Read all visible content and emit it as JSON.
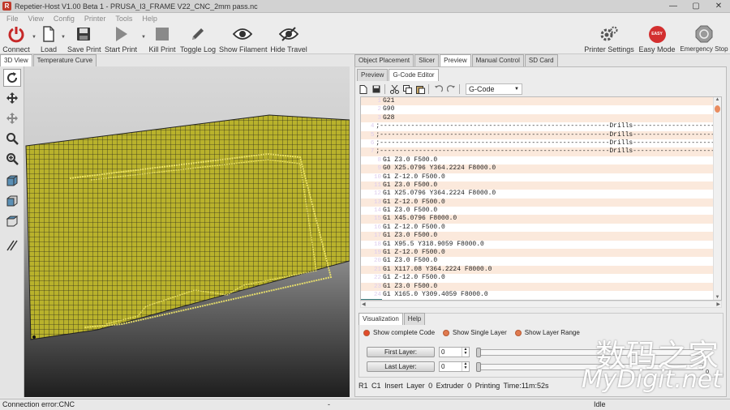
{
  "window": {
    "app_icon": "R",
    "title": "Repetier-Host V1.00 Beta 1 - PRUSA_I3_FRAME V22_CNC_2mm pass.nc",
    "minimize": "—",
    "maximize": "▢",
    "close": "✕"
  },
  "menu": [
    "File",
    "View",
    "Config",
    "Printer",
    "Tools",
    "Help"
  ],
  "toolbar": {
    "connect": "Connect",
    "load": "Load",
    "save_print": "Save Print",
    "start_print": "Start Print",
    "kill_print": "Kill Print",
    "toggle_log": "Toggle Log",
    "show_filament": "Show Filament",
    "hide_travel": "Hide Travel",
    "printer_settings": "Printer Settings",
    "easy_mode": "Easy Mode",
    "easy_badge": "EASY",
    "emergency_stop": "Emergency Stop"
  },
  "left_tabs": [
    "3D View",
    "Temperature Curve"
  ],
  "right_tabs": [
    "Object Placement",
    "Slicer",
    "Preview",
    "Manual Control",
    "SD Card"
  ],
  "preview_subtabs": [
    "Preview",
    "G-Code Editor"
  ],
  "editor": {
    "file_select": "G-Code",
    "lines": [
      {
        "n": "1",
        "code": "G21"
      },
      {
        "n": "2",
        "code": "G90"
      },
      {
        "n": "3",
        "code": "G28"
      },
      {
        "n": "4",
        "code": ";-----------------------------------------------------------Drills---------------------"
      },
      {
        "n": "5",
        "code": ";-----------------------------------------------------------Drills---------------------"
      },
      {
        "n": "6",
        "code": ";-----------------------------------------------------------Drills---------------------"
      },
      {
        "n": "7",
        "code": ";-----------------------------------------------------------Drills---------------------"
      },
      {
        "n": "8",
        "code": "G1 Z3.0 F500.0"
      },
      {
        "n": "9",
        "code": "G0 X25.0796 Y364.2224 F8000.0"
      },
      {
        "n": "10",
        "code": "G1 Z-12.0 F500.0"
      },
      {
        "n": "11",
        "code": "G1 Z3.0 F500.0"
      },
      {
        "n": "12",
        "code": "G1 X25.0796 Y364.2224 F8000.0"
      },
      {
        "n": "13",
        "code": "G1 Z-12.0 F500.0"
      },
      {
        "n": "14",
        "code": "G1 Z3.0 F500.0"
      },
      {
        "n": "15",
        "code": "G1 X45.0796 F8000.0"
      },
      {
        "n": "16",
        "code": "G1 Z-12.0 F500.0"
      },
      {
        "n": "17",
        "code": "G1 Z3.0 F500.0"
      },
      {
        "n": "18",
        "code": "G1 X95.5 Y318.9059 F8000.0"
      },
      {
        "n": "19",
        "code": "G1 Z-12.0 F500.0"
      },
      {
        "n": "20",
        "code": "G1 Z3.0 F500.0"
      },
      {
        "n": "21",
        "code": "G1 X117.08 Y364.2224 F8000.0"
      },
      {
        "n": "22",
        "code": "G1 Z-12.0 F500.0"
      },
      {
        "n": "23",
        "code": "G1 Z3.0 F500.0"
      },
      {
        "n": "24",
        "code": "G1 X165.0 Y309.4059 F8000.0"
      }
    ]
  },
  "visualization": {
    "tabs": [
      "Visualization",
      "Help"
    ],
    "options": [
      "Show complete Code",
      "Show Single Layer",
      "Show Layer Range"
    ],
    "first_layer_label": "First Layer:",
    "first_layer_value": "0",
    "last_layer_label": "Last Layer:",
    "last_layer_value": "0",
    "slider_end_value": "0"
  },
  "editor_status": {
    "row": "R1",
    "col": "C1",
    "mode": "Insert",
    "layer": "Layer 0",
    "extruder": "Extruder 0",
    "printing_time": "Printing Time:11m:52s"
  },
  "statusbar": {
    "connection": "Connection error:CNC",
    "mid": "-",
    "state": "Idle"
  },
  "watermark": {
    "cn": "数码之家",
    "en": "MyDigit.net"
  },
  "colors": {
    "connect_red": "#c62828",
    "easy_red": "#d32f2f",
    "bed_yellow": "#b9b22c",
    "gutter_teal": "#3d7f80"
  }
}
